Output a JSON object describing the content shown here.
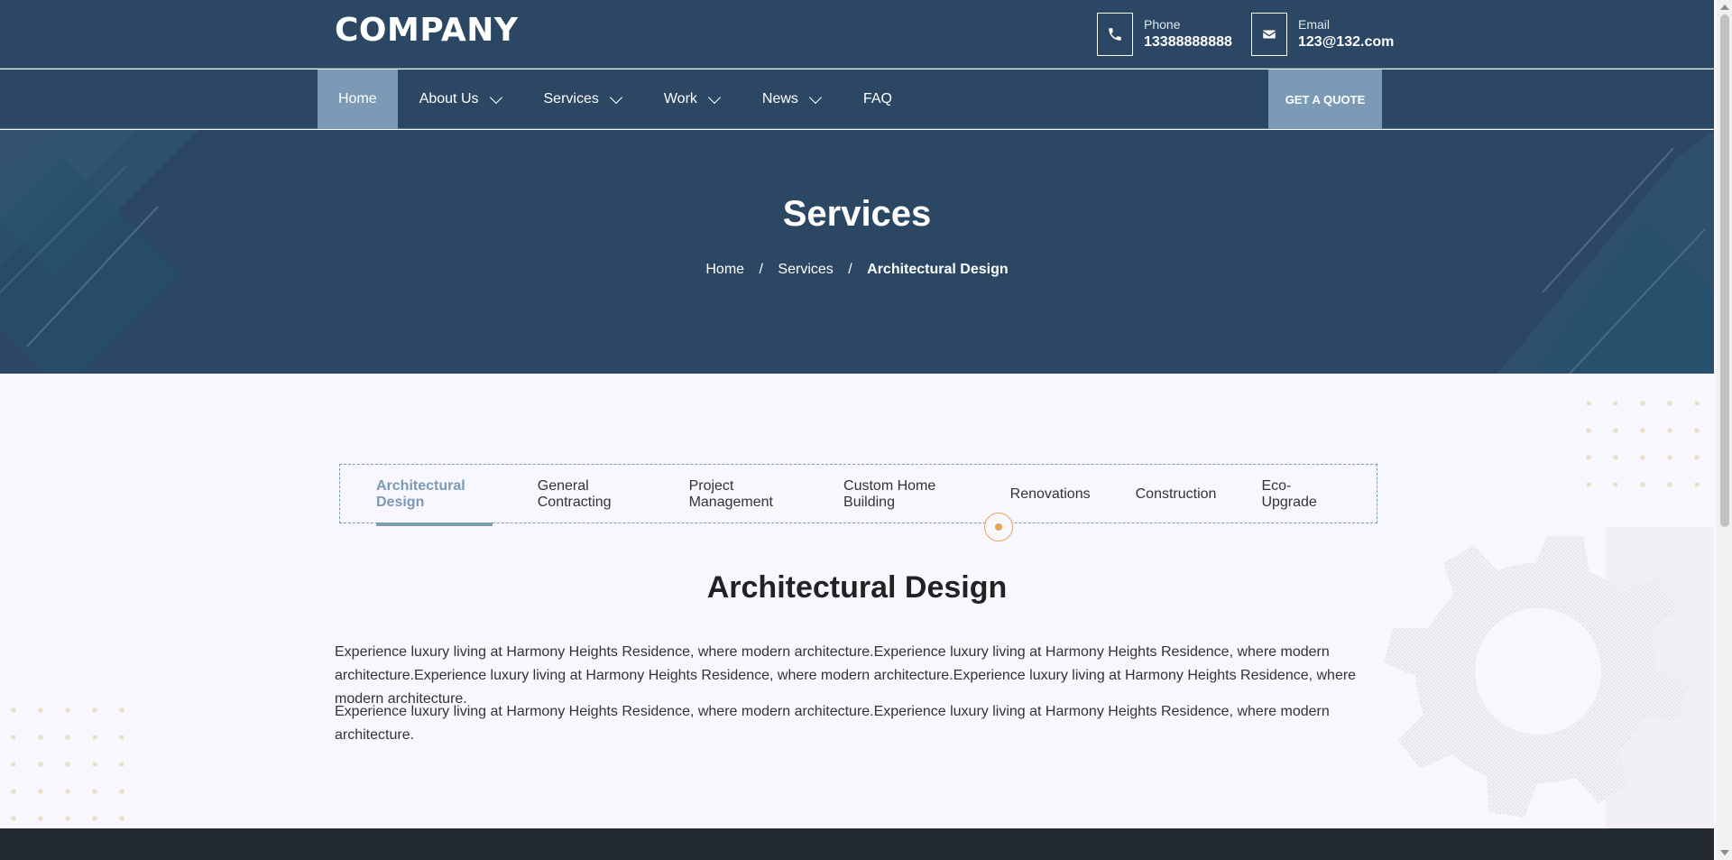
{
  "header": {
    "logo": "COMPANY",
    "phone": {
      "label": "Phone",
      "value": "13388888888",
      "icon": "phone-icon"
    },
    "email": {
      "label": "Email",
      "value": "123@132.com",
      "icon": "envelope-icon"
    }
  },
  "nav": {
    "items": [
      {
        "label": "Home",
        "active": true,
        "dropdown": false
      },
      {
        "label": "About Us",
        "dropdown": true
      },
      {
        "label": "Services",
        "dropdown": true
      },
      {
        "label": "Work",
        "dropdown": true
      },
      {
        "label": "News",
        "dropdown": true
      },
      {
        "label": "FAQ",
        "dropdown": false
      }
    ],
    "cta": "GET A QUOTE"
  },
  "hero": {
    "title": "Services",
    "breadcrumb": [
      "Home",
      "Services",
      "Architectural Design"
    ],
    "separator": "/"
  },
  "tabs": {
    "items": [
      "Architectural Design",
      "General Contracting",
      "Project Management",
      "Custom Home Building",
      "Renovations",
      "Construction",
      "Eco-Upgrade"
    ],
    "active_index": 0
  },
  "content": {
    "title": "Architectural Design",
    "paragraphs": [
      "Experience luxury living at Harmony Heights Residence, where modern architecture.Experience luxury living at Harmony Heights Residence, where modern architecture.Experience luxury living at Harmony Heights Residence, where modern architecture.Experience luxury living at Harmony Heights Residence, where modern architecture.",
      "Experience luxury living at Harmony Heights Residence, where modern architecture.Experience luxury living at Harmony Heights Residence, where modern architecture."
    ]
  },
  "colors": {
    "primary": "#2b4763",
    "accent": "#7b9ab6",
    "marker": "#e8a35a",
    "footer": "#232a33",
    "background": "#f8f7fd"
  }
}
